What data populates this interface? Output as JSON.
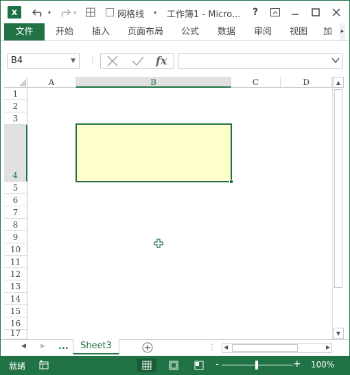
{
  "title_bar": {
    "app_icon": "excel-logo-icon",
    "logo_letter": "X",
    "gridlines_label": "网格线",
    "gridlines_checked": false,
    "title": "工作簿1 - Micro...",
    "help": "?",
    "controls": [
      "ribbon-display-icon",
      "minimize-icon",
      "maximize-icon",
      "close-icon"
    ]
  },
  "ribbon": {
    "tabs": [
      "文件",
      "开始",
      "插入",
      "页面布局",
      "公式",
      "数据",
      "审阅",
      "视图",
      "加载"
    ]
  },
  "formula_bar": {
    "name_box": "B4",
    "cancel_icon": "cancel-x-icon",
    "enter_icon": "enter-check-icon",
    "fx_label": "fx",
    "formula": ""
  },
  "grid": {
    "columns": [
      "A",
      "B",
      "C",
      "D"
    ],
    "selected_column": "B",
    "rows": [
      "1",
      "2",
      "3",
      "4",
      "5",
      "6",
      "7",
      "8",
      "9",
      "10",
      "11",
      "12",
      "13",
      "14",
      "15",
      "16",
      "17"
    ],
    "selected_row": "4",
    "selected_cell": "B4",
    "selected_cell_fill": "#ffffcc"
  },
  "sheet_bar": {
    "more": "...",
    "active_sheet": "Sheet3",
    "add_sheet_icon": "add-sheet-icon"
  },
  "status_bar": {
    "ready": "就绪",
    "zoom": "100%",
    "zoom_minus": "-",
    "zoom_plus": "+",
    "active_view": "normal-view"
  },
  "colors": {
    "accent": "#217346",
    "header_selected_bg": "#e1e1e1"
  }
}
